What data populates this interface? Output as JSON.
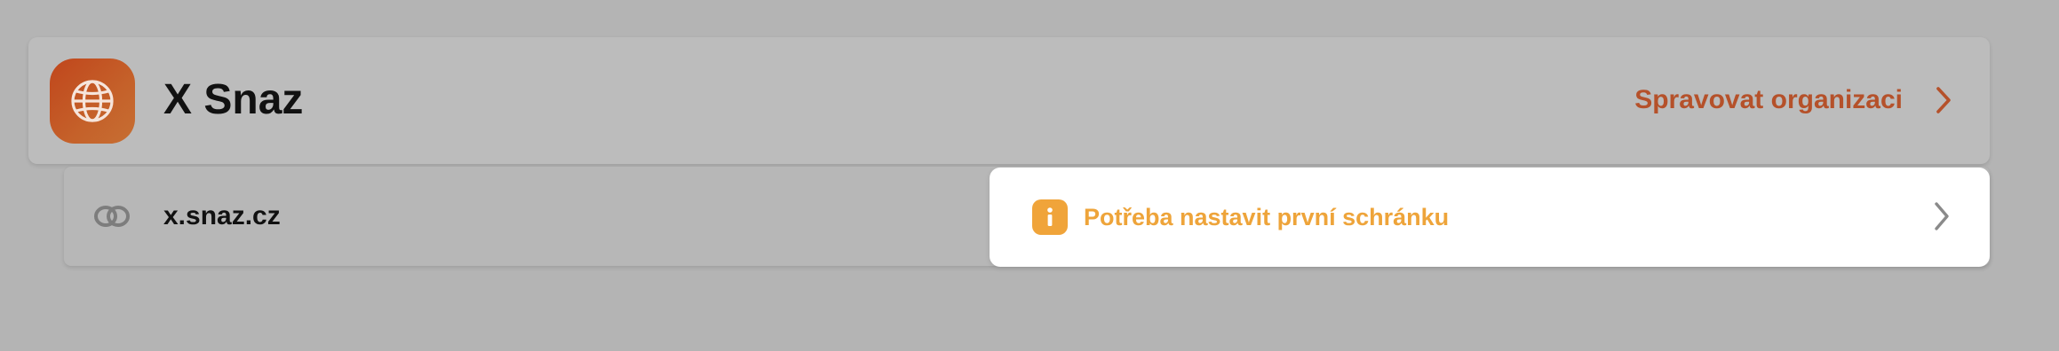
{
  "organization": {
    "name": "X Snaz",
    "logo_icon": "globe-icon",
    "manage_label": "Spravovat organizaci",
    "accent_color": "#b5512a"
  },
  "domain": {
    "name": "x.snaz.cz",
    "icon": "link-icon"
  },
  "setup_alert": {
    "message": "Potřeba nastavit první schránku",
    "icon": "info-icon",
    "color": "#eea43a"
  }
}
